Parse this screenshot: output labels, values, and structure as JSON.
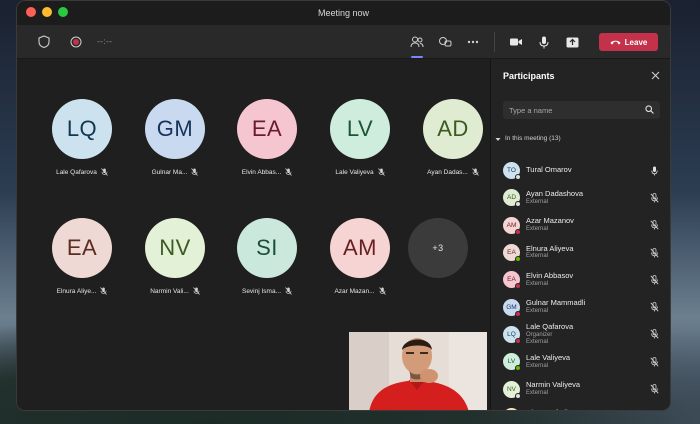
{
  "window": {
    "title": "Meeting now"
  },
  "toolbar": {
    "timer": "--:--",
    "leave_label": "Leave"
  },
  "stage": {
    "tiles": [
      {
        "initials": "LQ",
        "name": "Lale Qafarova",
        "bg": "#cde2ef",
        "fg": "#12384f"
      },
      {
        "initials": "GM",
        "name": "Gulnar Ma...",
        "bg": "#c9daf0",
        "fg": "#16335a"
      },
      {
        "initials": "EA",
        "name": "Elvin Abbas...",
        "bg": "#f5c6d0",
        "fg": "#6a1c2c"
      },
      {
        "initials": "LV",
        "name": "Lale Valiyeva",
        "bg": "#cfeddc",
        "fg": "#1e5333"
      },
      {
        "initials": "AD",
        "name": "Ayan Dadas...",
        "bg": "#dfecd2",
        "fg": "#3a5a22"
      },
      {
        "initials": "EA",
        "name": "Elnura Aliye...",
        "bg": "#eed9d4",
        "fg": "#5c2c22"
      },
      {
        "initials": "NV",
        "name": "Narmin Vali...",
        "bg": "#e3f1d6",
        "fg": "#3c5a24"
      },
      {
        "initials": "SI",
        "name": "Sevinj Isma...",
        "bg": "#cbe8dc",
        "fg": "#1d4d3b"
      },
      {
        "initials": "AM",
        "name": "Azar Mazan...",
        "bg": "#f6d4d4",
        "fg": "#6a2020"
      }
    ],
    "more_label": "+3"
  },
  "panel": {
    "title": "Participants",
    "search_placeholder": "Type a name",
    "section_label": "In this meeting (13)",
    "participants": [
      {
        "initials": "TO",
        "name": "Tural Omarov",
        "sub": "",
        "sub2": "",
        "bg": "#cde2ef",
        "fg": "#12384f",
        "status": "#e0e0e0",
        "mic": "on"
      },
      {
        "initials": "AD",
        "name": "Ayan Dadashova",
        "sub": "External",
        "sub2": "",
        "bg": "#dfecd2",
        "fg": "#3a5a22",
        "status": "#e0e0e0",
        "mic": "off"
      },
      {
        "initials": "AM",
        "name": "Azar Mazanov",
        "sub": "External",
        "sub2": "",
        "bg": "#f6d4d4",
        "fg": "#6a2020",
        "status": "#c4314b",
        "mic": "off"
      },
      {
        "initials": "EA",
        "name": "Elnura Aliyeva",
        "sub": "External",
        "sub2": "",
        "bg": "#eed9d4",
        "fg": "#5c2c22",
        "status": "#6bb700",
        "mic": "off"
      },
      {
        "initials": "EA",
        "name": "Elvin Abbasov",
        "sub": "External",
        "sub2": "",
        "bg": "#f5c6d0",
        "fg": "#6a1c2c",
        "status": "#c4314b",
        "mic": "off"
      },
      {
        "initials": "GM",
        "name": "Gulnar Mammadli",
        "sub": "External",
        "sub2": "",
        "bg": "#c9daf0",
        "fg": "#16335a",
        "status": "#c4314b",
        "mic": "off"
      },
      {
        "initials": "LQ",
        "name": "Lale Qafarova",
        "sub": "Organizer",
        "sub2": "External",
        "bg": "#cde2ef",
        "fg": "#12384f",
        "status": "#c4314b",
        "mic": "off"
      },
      {
        "initials": "LV",
        "name": "Lale Valiyeva",
        "sub": "External",
        "sub2": "",
        "bg": "#cfeddc",
        "fg": "#1e5333",
        "status": "#6bb700",
        "mic": "off"
      },
      {
        "initials": "NV",
        "name": "Narmin Valiyeva",
        "sub": "External",
        "sub2": "",
        "bg": "#e3f1d6",
        "fg": "#3c5a24",
        "status": "#e0e0e0",
        "mic": "off"
      },
      {
        "initials": "NC",
        "name": "Nigar Cafarli",
        "sub": "External",
        "sub2": "",
        "bg": "#f4e3b8",
        "fg": "#6a4e12",
        "status": "#c4314b",
        "mic": "off"
      }
    ]
  },
  "icons": {
    "shield": "shield-icon",
    "record": "record-icon",
    "people": "people-icon",
    "chat": "chat-icon",
    "more": "more-icon",
    "camera": "camera-icon",
    "mic": "mic-icon",
    "share": "share-icon",
    "phone": "phone-hangup-icon",
    "close": "close-icon",
    "search": "search-icon",
    "mic_off": "mic-off-icon"
  },
  "colors": {
    "accent": "#7f85f5",
    "leave": "#c4314b"
  }
}
